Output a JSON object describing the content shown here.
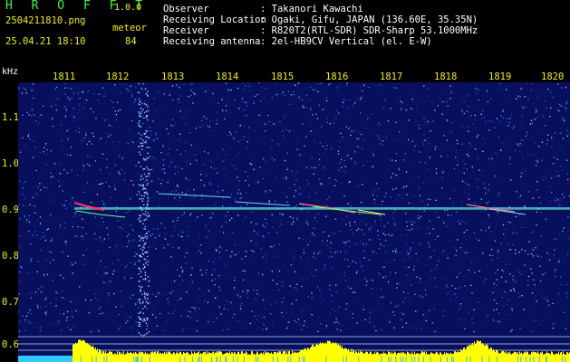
{
  "header": {
    "logo": "H R O F F T",
    "version": "1.0.0",
    "filename": "2504211810.png",
    "datetime": "25.04.21 18:10",
    "meteor_label": "meteor",
    "meteor_count": "84",
    "info": [
      {
        "key": "Observer",
        "value": ": Takanori Kawachi"
      },
      {
        "key": "Receiving Location",
        "value": ": Ogaki, Gifu, JAPAN (136.60E, 35.35N)"
      },
      {
        "key": "Receiver",
        "value": ": R820T2(RTL-SDR) SDR-Sharp 53.1000MHz"
      },
      {
        "key": "Receiving antenna",
        "value": ": 2el-HB9CV Vertical (el. E-W)"
      }
    ]
  },
  "spectrogram": {
    "y_unit": "kHz",
    "x_ticks": [
      "1811",
      "1812",
      "1813",
      "1814",
      "1815",
      "1816",
      "1817",
      "1818",
      "1819",
      "1820"
    ],
    "y_ticks": [
      "1.1",
      "1.0",
      "0.9",
      "0.8",
      "0.7",
      "0.6"
    ],
    "colors": {
      "background": "#08105e",
      "carrier": "#40e0ff",
      "power": "#ffff00",
      "label": "#f0f000"
    }
  }
}
